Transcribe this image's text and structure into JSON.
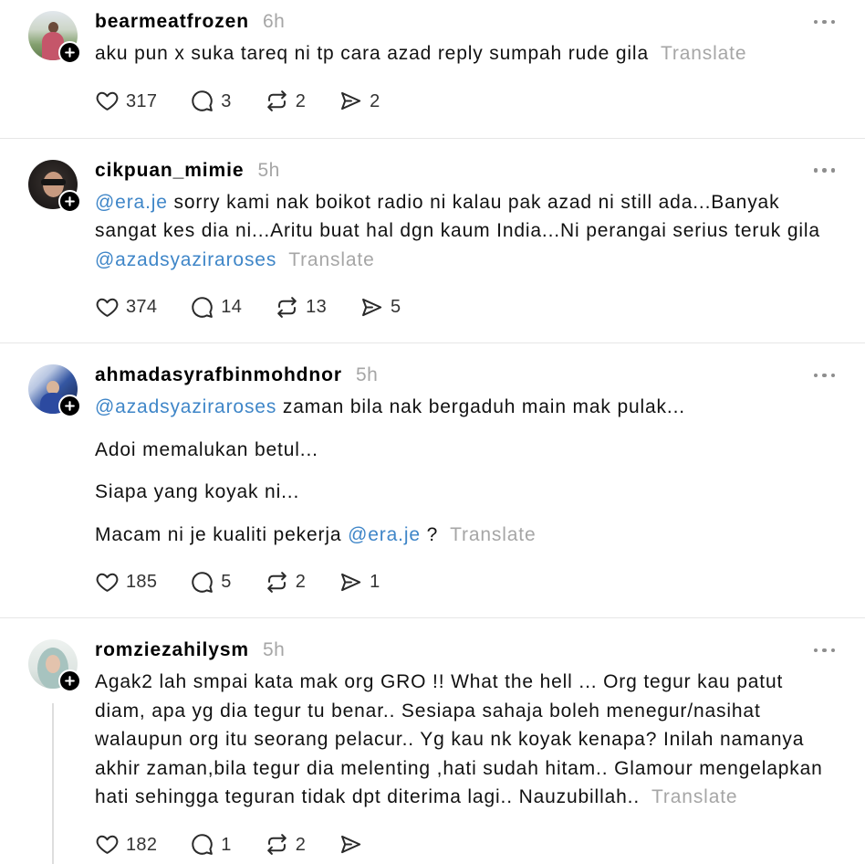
{
  "ui": {
    "translate_label": "Translate"
  },
  "colors": {
    "mention": "#3f86c8",
    "secondary_text": "#a6a6a6",
    "primary_text": "#111111",
    "divider": "#e6e6e6",
    "icon": "#2a2a2a",
    "follow_badge": "#000000"
  },
  "icons": {
    "like": "heart-icon",
    "reply": "comment-icon",
    "repost": "repost-icon",
    "share": "share-icon",
    "more": "ellipsis-icon",
    "follow": "plus-icon"
  },
  "posts": [
    {
      "username": "bearmeatfrozen",
      "time": "6h",
      "lines": [
        {
          "text": "aku pun x suka tareq ni tp cara azad reply sumpah rude gila"
        }
      ],
      "actions": {
        "likes": "317",
        "replies": "3",
        "reposts": "2",
        "shares": "2"
      }
    },
    {
      "username": "cikpuan_mimie",
      "time": "5h",
      "lines": [
        {
          "mention": "@era.je",
          "text": " sorry kami nak boikot radio ni kalau pak azad ni still ada...Banyak"
        },
        {
          "text": "sangat kes dia ni...Aritu buat hal dgn kaum India...Ni perangai serius teruk gila"
        },
        {
          "mention": "@azadsyaziraroses"
        }
      ],
      "actions": {
        "likes": "374",
        "replies": "14",
        "reposts": "13",
        "shares": "5"
      }
    },
    {
      "username": "ahmadasyrafbinmohdnor",
      "time": "5h",
      "lines": [
        {
          "mention": "@azadsyaziraroses",
          "text": " zaman bila nak bergaduh main mak pulak..."
        },
        {
          "text": "Adoi memalukan betul..."
        },
        {
          "text": "Siapa yang koyak ni..."
        },
        {
          "text": "Macam ni je kualiti pekerja ",
          "mention": "@era.je",
          "text_after": " ?"
        }
      ],
      "actions": {
        "likes": "185",
        "replies": "5",
        "reposts": "2",
        "shares": "1"
      }
    },
    {
      "username": "romziezahilysm",
      "time": "5h",
      "lines": [
        {
          "text": "Agak2 lah smpai kata mak org GRO !! What the hell ... Org tegur kau patut"
        },
        {
          "text": "diam, apa yg dia tegur tu benar.. Sesiapa sahaja boleh menegur/nasihat"
        },
        {
          "text": "walaupun org itu seorang pelacur.. Yg kau nk koyak kenapa? Inilah namanya"
        },
        {
          "text": "akhir zaman,bila tegur dia melenting ,hati sudah hitam.. Glamour mengelapkan"
        },
        {
          "text": "hati sehingga teguran tidak dpt diterima lagi.. Nauzubillah.."
        }
      ],
      "actions": {
        "likes": "182",
        "replies": "1",
        "reposts": "2"
      }
    }
  ]
}
